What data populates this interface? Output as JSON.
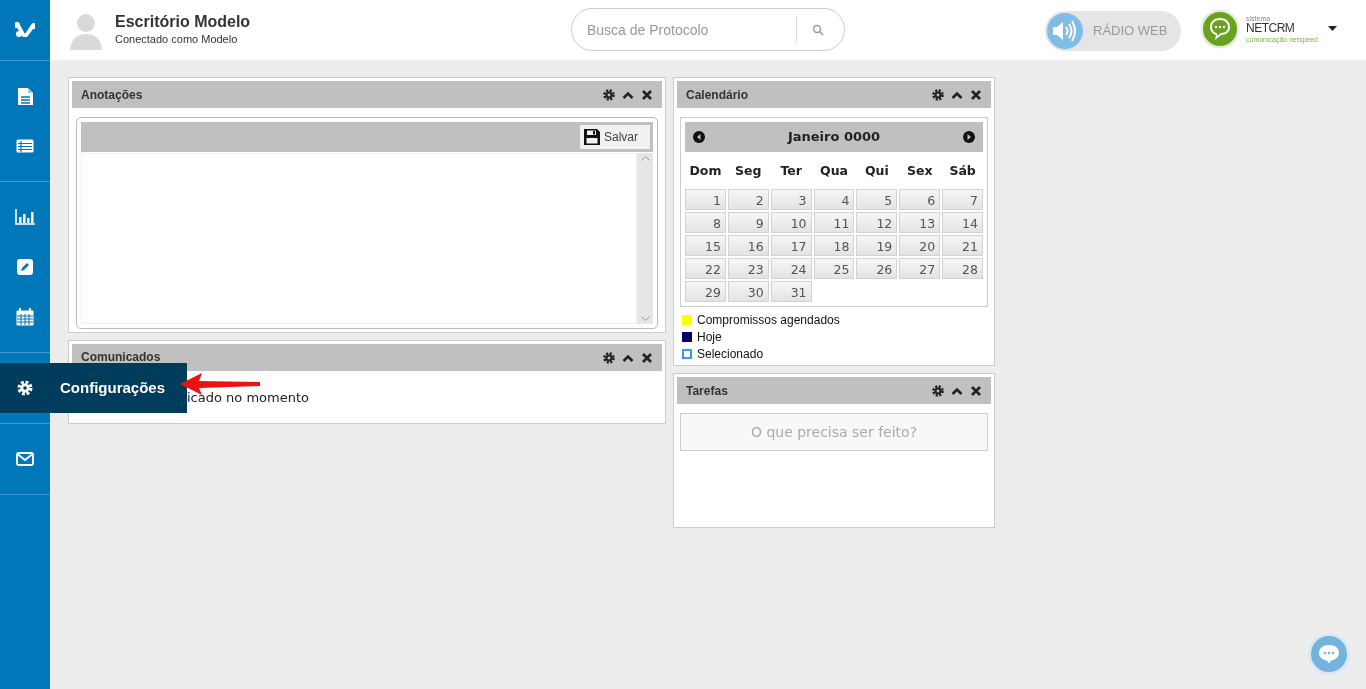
{
  "sidebar": {
    "groups": [
      [
        {
          "kind": "logo"
        }
      ],
      [
        {
          "kind": "document"
        },
        {
          "kind": "list"
        }
      ],
      [
        {
          "kind": "chart"
        },
        {
          "kind": "edit"
        },
        {
          "kind": "calendar"
        }
      ],
      [
        {
          "kind": "settings",
          "label": "Configurações",
          "expanded": true
        }
      ],
      [
        {
          "kind": "mail"
        }
      ]
    ]
  },
  "header": {
    "title": "Escritório Modelo",
    "subtitle": "Conectado como Modelo"
  },
  "search": {
    "placeholder": "Busca de Protocolo"
  },
  "radio": {
    "label": "RÁDIO WEB"
  },
  "brand": {
    "top": "sistema",
    "name": "NETCRM",
    "tagline": "comunicação netspeed"
  },
  "columns": [
    [
      {
        "kind": "notes",
        "title": "Anotações",
        "save_label": "Salvar"
      },
      {
        "kind": "messages",
        "title": "Comunicados",
        "message": "icado no momento"
      }
    ],
    [
      {
        "kind": "calendar",
        "title": "Calendário",
        "month": "Janeiro 0000",
        "weekdays": [
          "Dom",
          "Seg",
          "Ter",
          "Qua",
          "Qui",
          "Sex",
          "Sáb"
        ],
        "weeks": [
          [
            "1",
            "2",
            "3",
            "4",
            "5",
            "6",
            "7"
          ],
          [
            "8",
            "9",
            "10",
            "11",
            "12",
            "13",
            "14"
          ],
          [
            "15",
            "16",
            "17",
            "18",
            "19",
            "20",
            "21"
          ],
          [
            "22",
            "23",
            "24",
            "25",
            "26",
            "27",
            "28"
          ],
          [
            "29",
            "30",
            "31"
          ]
        ],
        "legend": [
          {
            "kind": "fill",
            "color": "#ffff00",
            "label": "Compromissos agendados"
          },
          {
            "kind": "fill",
            "color": "#000066",
            "label": "Hoje"
          },
          {
            "kind": "outline",
            "color": "#3399ff",
            "label": "Selecionado"
          }
        ]
      },
      {
        "kind": "tasks",
        "title": "Tarefas",
        "placeholder": "O que precisa ser feito?"
      }
    ]
  ]
}
